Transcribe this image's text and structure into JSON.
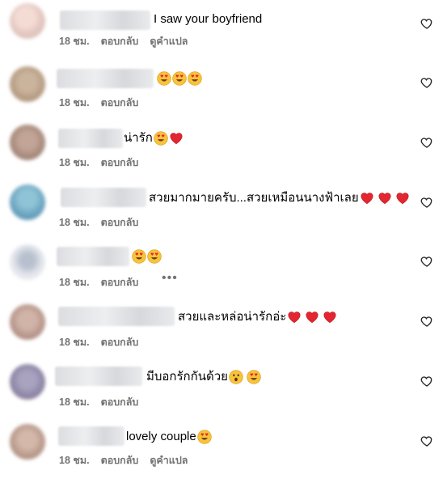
{
  "comments": [
    {
      "text": "I saw your boyfriend",
      "emojis": [],
      "time": "18 ชม.",
      "reply_label": "ตอบกลับ",
      "translate_label": "ดูคำแปล",
      "avatar_color": "#e3c7c1"
    },
    {
      "text": "",
      "emojis": [
        "heart-eyes-emoji",
        "heart-eyes-emoji",
        "heart-eyes-emoji"
      ],
      "time": "18 ชม.",
      "reply_label": "ตอบกลับ",
      "avatar_color": "#b79e86"
    },
    {
      "text": "น่ารัก",
      "emojis": [
        "heart-eyes-emoji",
        "red-heart-emoji"
      ],
      "time": "18 ชม.",
      "reply_label": "ตอบกลับ",
      "avatar_color": "#a88b7d"
    },
    {
      "text": "สวยมากมายครับ...สวยเหมือนนางฟ้าเลย",
      "emojis": [
        "red-heart-emoji",
        "red-heart-emoji",
        "red-heart-emoji"
      ],
      "time": "18 ชม.",
      "reply_label": "ตอบกลับ",
      "avatar_color": "#6aa3bf"
    },
    {
      "text": "",
      "emojis": [
        "heart-eyes-emoji",
        "heart-eyes-emoji"
      ],
      "time": "18 ชม.",
      "reply_label": "ตอบกลับ",
      "more_label": "•••",
      "avatar_color": "#c9ced8"
    },
    {
      "text": "สวยและหล่อน่ารักอ่ะ",
      "emojis": [
        "red-heart-emoji",
        "red-heart-emoji",
        "red-heart-emoji"
      ],
      "time": "18 ชม.",
      "reply_label": "ตอบกลับ",
      "avatar_color": "#b8978c"
    },
    {
      "text": "มีบอกรักกันด้วย",
      "emojis": [
        "surprised-emoji",
        "heart-eyes-emoji"
      ],
      "time": "18 ชม.",
      "reply_label": "ตอบกลับ",
      "avatar_color": "#8d86a6"
    },
    {
      "text": "lovely couple",
      "emojis": [
        "heart-eyes-emoji"
      ],
      "time": "18 ชม.",
      "reply_label": "ตอบกลับ",
      "translate_label": "ดูคำแปล",
      "avatar_color": "#b89a8c"
    }
  ]
}
